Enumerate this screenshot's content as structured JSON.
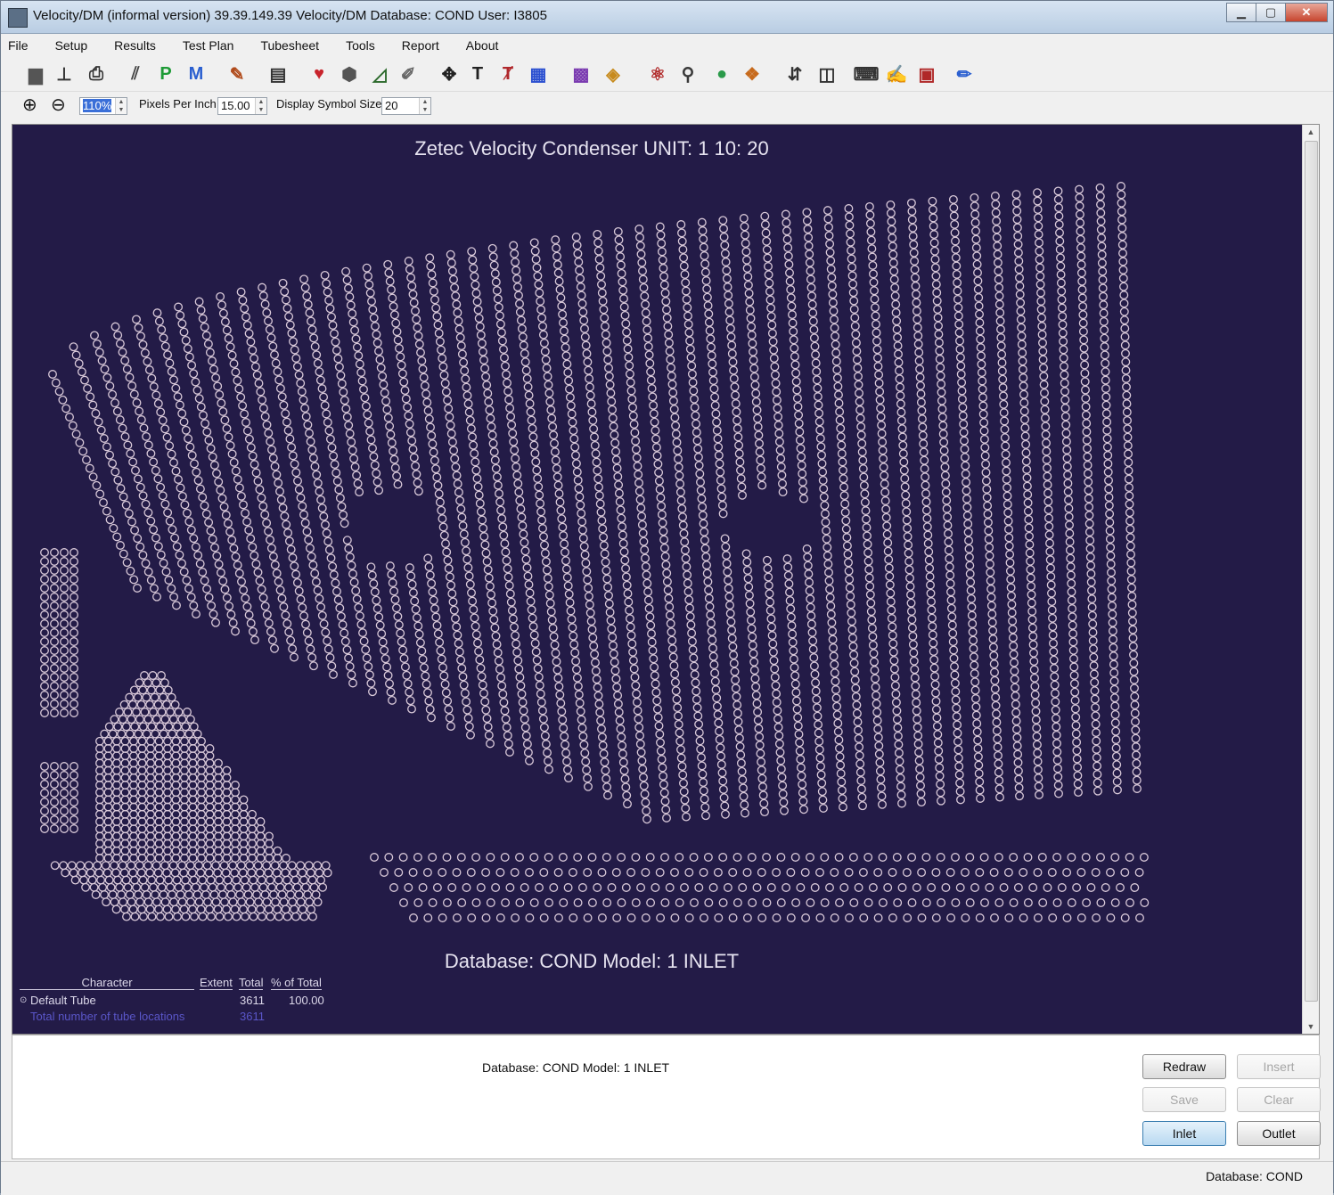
{
  "window": {
    "title": "Velocity/DM (informal version) 39.39.149.39 Velocity/DM   Database: COND User: I3805",
    "controls": {
      "minimize": "▁",
      "maximize": "▢",
      "close": "✕"
    }
  },
  "menu": [
    "File",
    "Setup",
    "Results",
    "Test Plan",
    "Tubesheet",
    "Tools",
    "Report",
    "About"
  ],
  "toolbar_icons": [
    {
      "name": "database-icon",
      "glyph": "▆",
      "color": "#555555"
    },
    {
      "name": "stand-icon",
      "glyph": "⊥",
      "color": "#333333"
    },
    {
      "name": "print-icon",
      "glyph": "⎙",
      "color": "#333333"
    },
    {
      "name": "probe-icon",
      "glyph": "⫽",
      "color": "#444444"
    },
    {
      "name": "p-icon",
      "glyph": "P",
      "color": "#1d9b36"
    },
    {
      "name": "m-icon",
      "glyph": "M",
      "color": "#2a5fd0"
    },
    {
      "name": "paint-icon",
      "glyph": "✎",
      "color": "#b04a1a"
    },
    {
      "name": "export-icon",
      "glyph": "▤",
      "color": "#333333"
    },
    {
      "name": "heart-icon",
      "glyph": "♥",
      "color": "#c8242c"
    },
    {
      "name": "hexagon-icon",
      "glyph": "⬢",
      "color": "#555555"
    },
    {
      "name": "ruler-icon",
      "glyph": "◿",
      "color": "#2c6a2c"
    },
    {
      "name": "brush-icon",
      "glyph": "✐",
      "color": "#666666"
    },
    {
      "name": "move-icon",
      "glyph": "✥",
      "color": "#222222"
    },
    {
      "name": "text-icon",
      "glyph": "T",
      "color": "#222222"
    },
    {
      "name": "tag-icon",
      "glyph": "Ⱦ",
      "color": "#b0282c"
    },
    {
      "name": "grid-icon",
      "glyph": "▦",
      "color": "#2a4fd0"
    },
    {
      "name": "color-grid-icon",
      "glyph": "▩",
      "color": "#7a3ab0"
    },
    {
      "name": "palette-icon",
      "glyph": "◈",
      "color": "#c78a1c"
    },
    {
      "name": "molecule-icon",
      "glyph": "⚛",
      "color": "#b02828"
    },
    {
      "name": "figure-icon",
      "glyph": "⚲",
      "color": "#3a3a3a"
    },
    {
      "name": "spheres-icon",
      "glyph": "●",
      "color": "#2a9a4a"
    },
    {
      "name": "cubes-icon",
      "glyph": "❖",
      "color": "#c76a1c"
    },
    {
      "name": "sort-icon",
      "glyph": "⇵",
      "color": "#333333"
    },
    {
      "name": "columns-icon",
      "glyph": "◫",
      "color": "#333333"
    },
    {
      "name": "monitor-icon",
      "glyph": "⌨",
      "color": "#333333"
    },
    {
      "name": "edit-chart-icon",
      "glyph": "✍",
      "color": "#333333"
    },
    {
      "name": "report-icon",
      "glyph": "▣",
      "color": "#b02828"
    },
    {
      "name": "notepad-icon",
      "glyph": "✏",
      "color": "#2a5fd0"
    }
  ],
  "zoom_bar": {
    "zoom_in_icon": "⊕",
    "zoom_out_icon": "⊖",
    "zoom_value": "110%",
    "pixels_per_inch_label": "Pixels Per Inch",
    "pixels_per_inch_value": "15.00",
    "symbol_size_label": "Display Symbol Size",
    "symbol_size_value": "20"
  },
  "plot": {
    "title": "Zetec Velocity Condenser UNIT: 1 10: 20",
    "footer": "Database: COND  Model: 1  INLET",
    "background": "#231b47",
    "tube_color": "#d8c8d8"
  },
  "legend": {
    "headers": [
      "Character",
      "Extent",
      "Total",
      "% of Total"
    ],
    "row": {
      "character": "Default Tube",
      "total": "3611",
      "percent": "100.00"
    },
    "total_row": {
      "label": "Total number of tube locations",
      "total": "3611"
    }
  },
  "bottom_panel": {
    "info": "Database: COND  Model: 1  INLET",
    "buttons": {
      "redraw": "Redraw",
      "insert": "Insert",
      "save": "Save",
      "clear": "Clear",
      "inlet": "Inlet",
      "outlet": "Outlet"
    }
  },
  "status": "Database: COND"
}
